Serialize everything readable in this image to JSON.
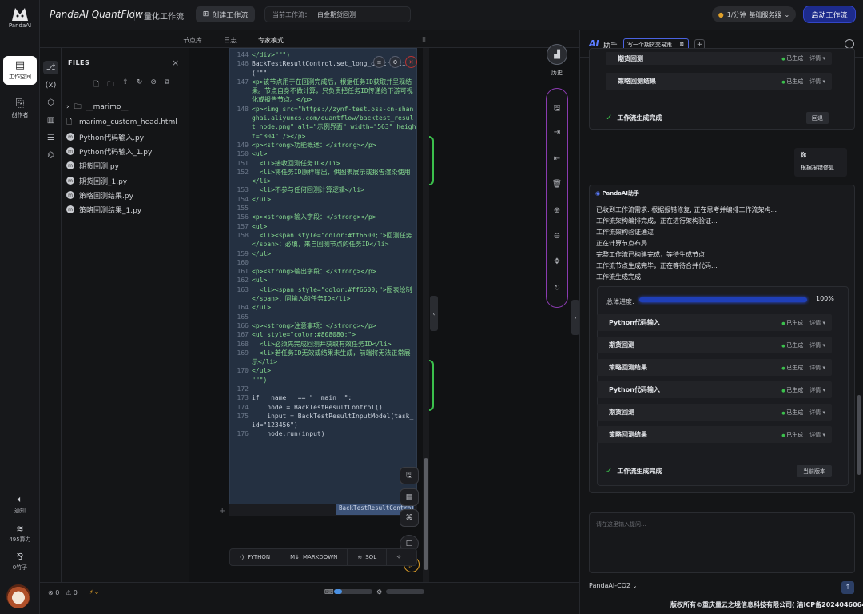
{
  "app": {
    "logo_text": "PandaAI",
    "title": "PandaAI QuantFlow",
    "subtitle": "量化工作流"
  },
  "topbar": {
    "create_button": "创建工作流",
    "current_flow_label": "当前工作流：",
    "current_flow_value": "白金期货回测",
    "server_label": "1/分钟",
    "server_plan": "基础服务器",
    "start_button": "启动工作流"
  },
  "nav": {
    "workspace": "工作空间",
    "creator": "创作者",
    "notice": "通知",
    "compute": "495算力",
    "bamboo": "0竹子"
  },
  "tabs": [
    "节点库",
    "日志",
    "专家模式"
  ],
  "files": {
    "header": "FILES",
    "folder": "__marimo__",
    "items": [
      "marimo_custom_head.html",
      "Python代码输入.py",
      "Python代码输入_1.py",
      "期货回测.py",
      "期货回测_1.py",
      "策略回测结果.py",
      "策略回测结果_1.py"
    ]
  },
  "code_lines": [
    {
      "n": "144",
      "t": "</div>\"\"\")",
      "k": "html"
    },
    {
      "n": "",
      "t": "",
      "k": "html"
    },
    {
      "n": "146",
      "t": "BackTestResultControl.set_long_description(\"\"\"",
      "k": "py"
    },
    {
      "n": "147",
      "t": "<p>该节点用于在回测完成后，根据任务ID获取并呈现结果。节点自身不做计算，只负责把任务ID传递给下游可视化或报告节点。</p>",
      "k": "html"
    },
    {
      "n": "148",
      "t": "<p><img src=\"https://zynf-test.oss-cn-shanghai.aliyuncs.com/quantflow/backtest_result_node.png\" alt=\"示例界面\" width=\"563\" height=\"304\" /></p>",
      "k": "html"
    },
    {
      "n": "149",
      "t": "<p><strong>功能概述：</strong></p>",
      "k": "html"
    },
    {
      "n": "150",
      "t": "<ul>",
      "k": "html"
    },
    {
      "n": "151",
      "t": "  <li>接收回测任务ID</li>",
      "k": "html"
    },
    {
      "n": "152",
      "t": "  <li>将任务ID原样输出，供图表展示或报告渲染使用</li>",
      "k": "html"
    },
    {
      "n": "153",
      "t": "  <li>不参与任何回测计算逻辑</li>",
      "k": "html"
    },
    {
      "n": "154",
      "t": "</ul>",
      "k": "html"
    },
    {
      "n": "155",
      "t": "",
      "k": "html"
    },
    {
      "n": "156",
      "t": "<p><strong>输入字段：</strong></p>",
      "k": "html"
    },
    {
      "n": "157",
      "t": "<ul>",
      "k": "html"
    },
    {
      "n": "158",
      "t": "  <li><span style=\"color:#ff6600;\">回测任务</span>：必填，来自回测节点的任务ID</li>",
      "k": "html"
    },
    {
      "n": "159",
      "t": "</ul>",
      "k": "html"
    },
    {
      "n": "160",
      "t": "",
      "k": "html"
    },
    {
      "n": "161",
      "t": "<p><strong>输出字段：</strong></p>",
      "k": "html"
    },
    {
      "n": "162",
      "t": "<ul>",
      "k": "html"
    },
    {
      "n": "163",
      "t": "  <li><span style=\"color:#ff6600;\">图表绘制</span>：同输入的任务ID</li>",
      "k": "html"
    },
    {
      "n": "164",
      "t": "</ul>",
      "k": "html"
    },
    {
      "n": "165",
      "t": "",
      "k": "html"
    },
    {
      "n": "166",
      "t": "<p><strong>注意事项：</strong></p>",
      "k": "html"
    },
    {
      "n": "167",
      "t": "<ul style=\"color:#808080;\">",
      "k": "html"
    },
    {
      "n": "168",
      "t": "  <li>必须先完成回测并获取有效任务ID</li>",
      "k": "html"
    },
    {
      "n": "169",
      "t": "  <li>若任务ID无效或结果未生成，前端将无法正常展示</li>",
      "k": "html"
    },
    {
      "n": "170",
      "t": "</ul>",
      "k": "html"
    },
    {
      "n": "",
      "t": "\"\"\")",
      "k": "html"
    },
    {
      "n": "172",
      "t": "",
      "k": "html"
    },
    {
      "n": "173",
      "t": "if __name__ == \"__main__\":",
      "k": "py"
    },
    {
      "n": "174",
      "t": "    node = BackTestResultControl()",
      "k": "py"
    },
    {
      "n": "175",
      "t": "    input = BackTestResultInputModel(task_id=\"123456\")",
      "k": "py"
    },
    {
      "n": "176",
      "t": "    node.run(input)",
      "k": "py"
    }
  ],
  "cell_tag": "BackTestResultControl",
  "lang_buttons": [
    "PYTHON",
    "MARKDOWN",
    "SQL"
  ],
  "bottom": {
    "errors": "0",
    "warnings": "0"
  },
  "history_label": "历史",
  "assistant": {
    "logo": "AI",
    "title": "助手",
    "chat_tab": "写一个期货交易策...",
    "top_steps": [
      {
        "name": "期货回测",
        "status": "已生成",
        "detail": "详情"
      },
      {
        "name": "策略回测结果",
        "status": "已生成",
        "detail": "详情"
      }
    ],
    "done_label": "工作流生成完成",
    "rollback": "回退",
    "user_name": "你",
    "user_msg": "根据报错修复",
    "bot_name": "PandaAI助手",
    "bot_lines": [
      "已收到工作流需求: 根据报错修复; 正在思考并编排工作流架构...",
      "工作流架构编排完成，正在进行架构验证...",
      "工作流架构验证通过",
      "正在计算节点布局...",
      "完整工作流已构建完成，等待生成节点",
      "工作流节点生成完毕，正在等待合并代码...",
      "工作流生成完成"
    ],
    "progress_label": "总体进度:",
    "progress_value": "100%",
    "progress_fraction": 1.0,
    "steps": [
      {
        "name": "Python代码输入",
        "status": "已生成",
        "detail": "详情"
      },
      {
        "name": "期货回测",
        "status": "已生成",
        "detail": "详情"
      },
      {
        "name": "策略回测结果",
        "status": "已生成",
        "detail": "详情"
      },
      {
        "name": "Python代码输入",
        "status": "已生成",
        "detail": "详情"
      },
      {
        "name": "期货回测",
        "status": "已生成",
        "detail": "详情"
      },
      {
        "name": "策略回测结果",
        "status": "已生成",
        "detail": "详情"
      }
    ],
    "current_version": "当前版本",
    "input_placeholder": "请在这里输入提问...",
    "model": "PandaAI-CQ2",
    "copyright": "版权所有©重庆量云之境信息科技有限公司( 渝ICP备2024046064号 )"
  }
}
